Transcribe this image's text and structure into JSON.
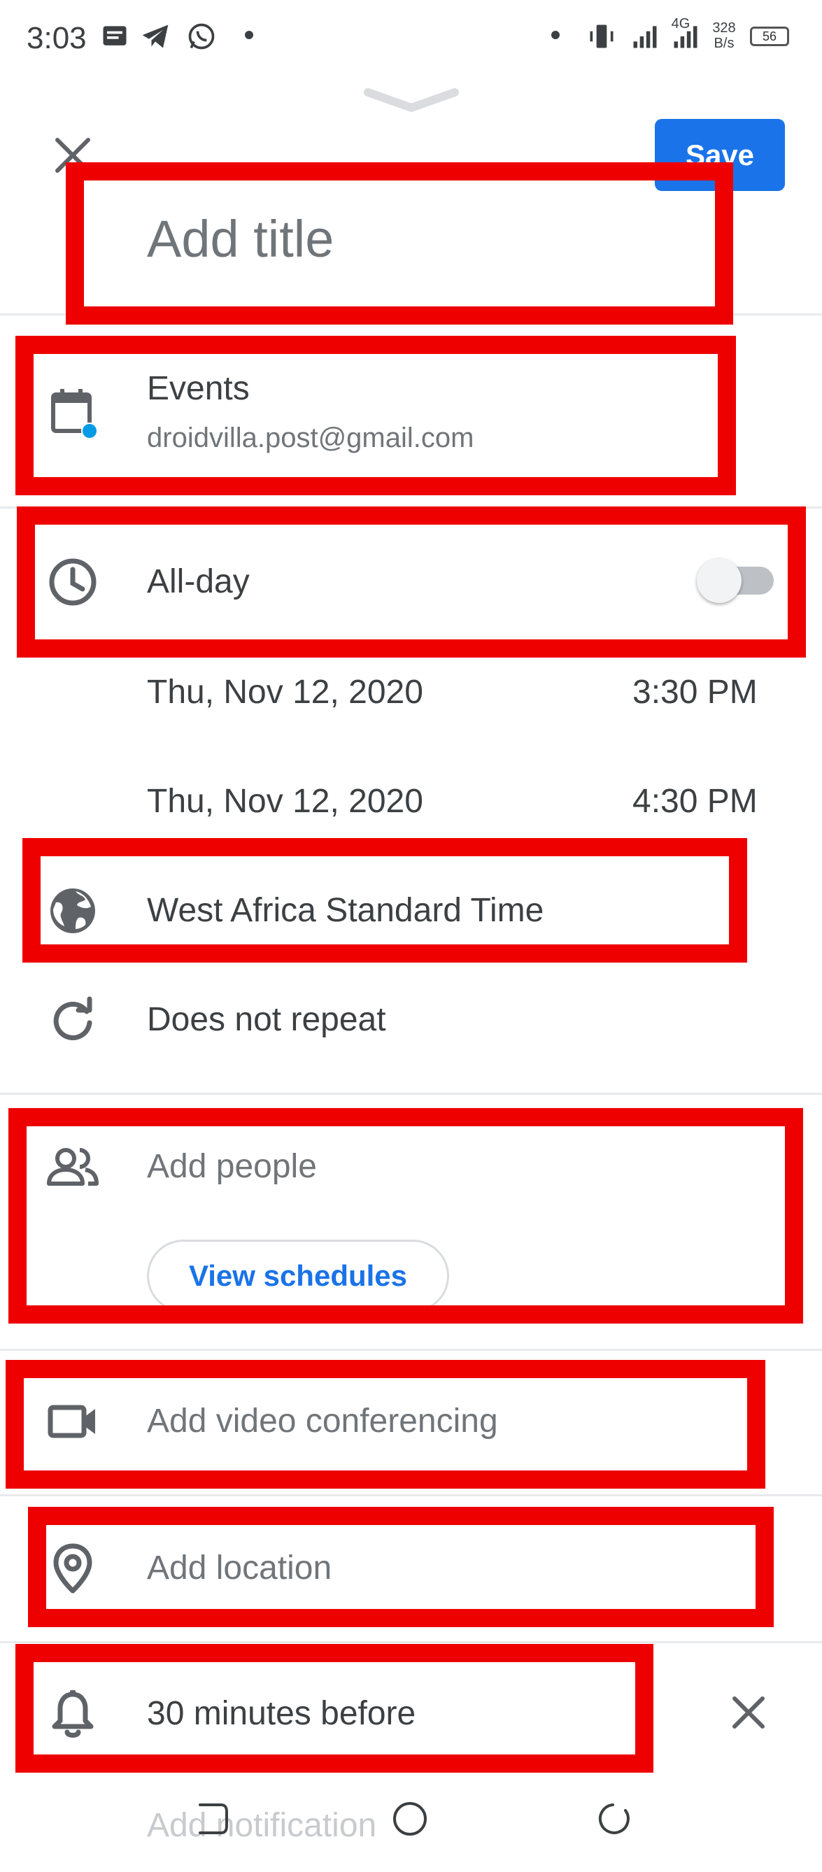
{
  "status_bar": {
    "time": "3:03",
    "network_type": "4G",
    "network_speed_value": "328",
    "network_speed_unit": "B/s",
    "battery": "56"
  },
  "header": {
    "close_icon": "close-icon",
    "save_label": "Save",
    "title_placeholder": "Add title"
  },
  "calendar": {
    "name": "Events",
    "account": "droidvilla.post@gmail.com"
  },
  "all_day": {
    "label": "All-day",
    "enabled": false
  },
  "start": {
    "date": "Thu, Nov 12, 2020",
    "time": "3:30 PM"
  },
  "end": {
    "date": "Thu, Nov 12, 2020",
    "time": "4:30 PM"
  },
  "timezone": "West Africa Standard Time",
  "repeat": "Does not repeat",
  "people": {
    "placeholder": "Add people",
    "view_schedules_label": "View schedules"
  },
  "video_conferencing": "Add video conferencing",
  "location": "Add location",
  "notification": {
    "label": "30 minutes before",
    "add_label": "Add notification"
  },
  "colors": {
    "accent": "#1a73e8",
    "highlight": "#ee0000",
    "calendar_dot": "#039be5"
  }
}
